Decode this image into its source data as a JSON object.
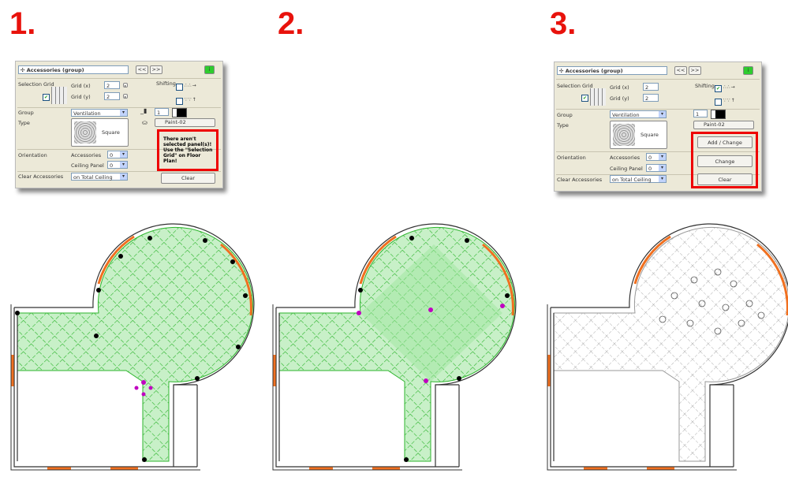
{
  "steps": [
    "1.",
    "2.",
    "3."
  ],
  "panel": {
    "title": "Accessories (group)",
    "prev": "<<",
    "next": ">>",
    "info": "i",
    "selection_grid": "Selection Grid",
    "grid_x_label": "Grid (x)",
    "grid_x": "2",
    "grid_y_label": "Grid (y)",
    "grid_y": "2",
    "shifting": "Shifting",
    "group_label": "Group",
    "group_value": "Ventilation",
    "type_label": "Type",
    "type_value": "Square",
    "pen": "1",
    "material": "Paint-02",
    "orientation": "Orientation",
    "accessories_label": "Accessories",
    "accessories_value": "0",
    "ceiling_panel_label": "Ceiling Panel",
    "ceiling_panel_value": "0",
    "clear_accessories": "Clear Accessories",
    "clear_value": "on Total Ceiling",
    "clear_button": "Clear",
    "add_change_button": "Add / Change",
    "change_button": "Change"
  },
  "panel1": {
    "shifting_x_checked": false,
    "message": "There aren't selected panel(s)! Use the \"Selection Grid\" on Floor Plan!"
  },
  "panel3": {
    "shifting_x_checked": true
  },
  "colors": {
    "accent": "#e8120c",
    "selection_fill": "#c8f0c8",
    "grid_line": "#2db52d",
    "wall_accent": "#f07020",
    "marker": "#c000c0"
  }
}
